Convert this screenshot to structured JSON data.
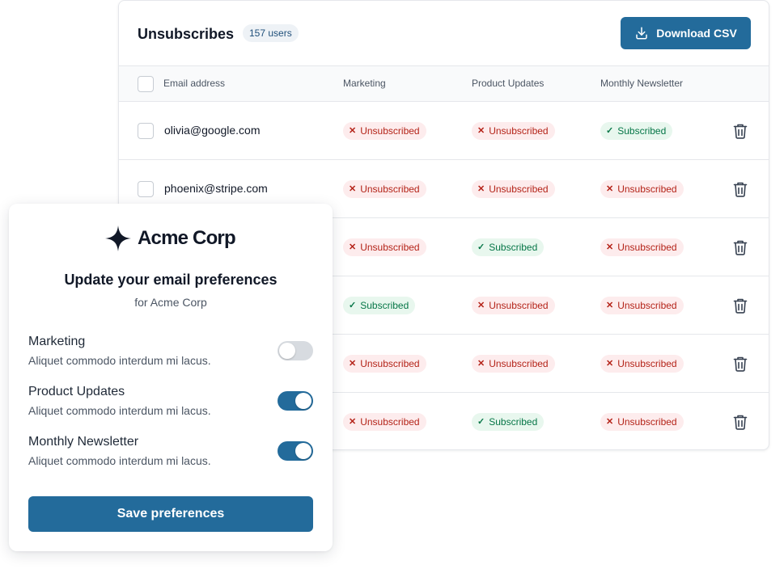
{
  "colors": {
    "accent": "#236b9b",
    "unsubscribed_bg": "#fdeced",
    "unsubscribed_text": "#b42318",
    "subscribed_bg": "#e8f7ee",
    "subscribed_text": "#067647"
  },
  "unsubscribes": {
    "title": "Unsubscribes",
    "count_badge": "157 users",
    "download_label": "Download CSV",
    "download_icon": "download-icon",
    "columns": [
      "Email address",
      "Marketing",
      "Product Updates",
      "Monthly Newsletter"
    ],
    "rows": [
      {
        "email": "olivia@google.com",
        "marketing": "Unsubscribed",
        "product_updates": "Unsubscribed",
        "newsletter": "Subscribed"
      },
      {
        "email": "phoenix@stripe.com",
        "marketing": "Unsubscribed",
        "product_updates": "Unsubscribed",
        "newsletter": "Unsubscribed"
      },
      {
        "email": "",
        "marketing": "Unsubscribed",
        "product_updates": "Subscribed",
        "newsletter": "Unsubscribed"
      },
      {
        "email": "",
        "marketing": "Subscribed",
        "product_updates": "Unsubscribed",
        "newsletter": "Unsubscribed"
      },
      {
        "email": "",
        "marketing": "Unsubscribed",
        "product_updates": "Unsubscribed",
        "newsletter": "Unsubscribed"
      },
      {
        "email": "",
        "marketing": "Unsubscribed",
        "product_updates": "Subscribed",
        "newsletter": "Unsubscribed"
      }
    ],
    "row_action_icon": "trash-icon"
  },
  "preferences": {
    "brand": "Acme Corp",
    "brand_icon": "four-point-star-icon",
    "title": "Update your email preferences",
    "subtitle": "for Acme Corp",
    "items": [
      {
        "label": "Marketing",
        "description": "Aliquet commodo interdum mi lacus.",
        "enabled": false
      },
      {
        "label": "Product Updates",
        "description": "Aliquet commodo interdum mi lacus.",
        "enabled": true
      },
      {
        "label": "Monthly Newsletter",
        "description": "Aliquet commodo interdum mi lacus.",
        "enabled": true
      }
    ],
    "save_label": "Save preferences"
  }
}
